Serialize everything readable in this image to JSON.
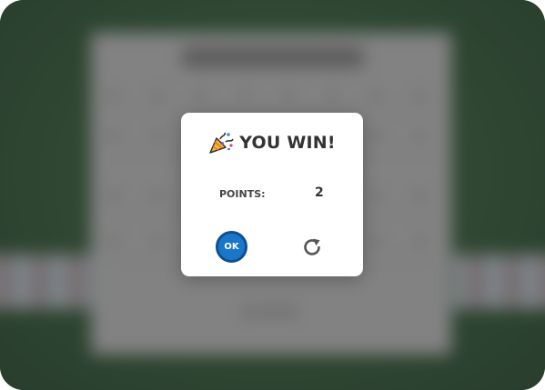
{
  "modal": {
    "title": "YOU WIN!",
    "title_icon": "party-popper-icon",
    "points_label": "POINTS:",
    "points_value": "2",
    "ok_label": "OK",
    "replay_icon": "refresh-icon"
  },
  "colors": {
    "table_felt": "#2c4a31",
    "ok_button": "#1a76c9",
    "ok_button_border": "#0e4f93",
    "title_text": "#333333"
  }
}
